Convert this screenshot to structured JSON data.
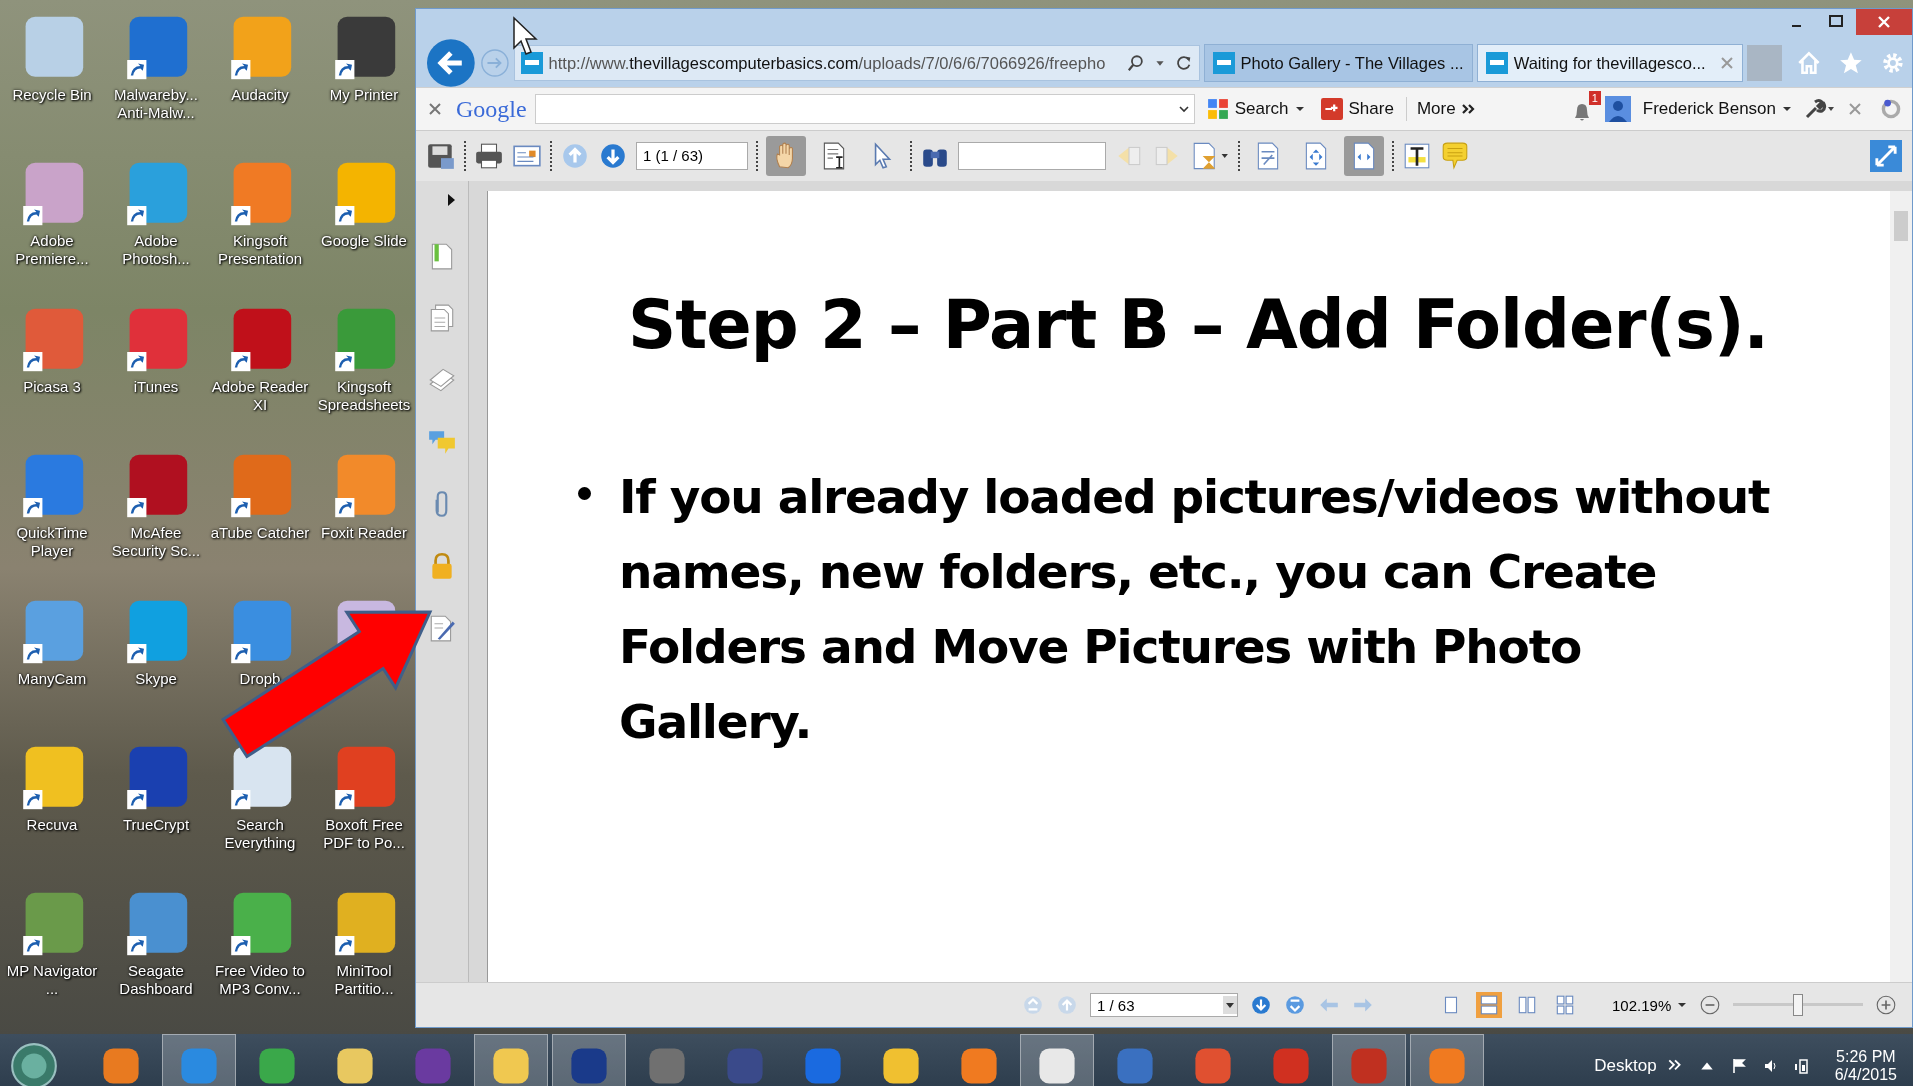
{
  "desktop_icons": [
    {
      "label": "Recycle Bin",
      "shortcut": false,
      "color": "#b8d0e6"
    },
    {
      "label": "Malwareby... Anti-Malw...",
      "shortcut": true,
      "color": "#1f6fd0"
    },
    {
      "label": "Audacity",
      "shortcut": true,
      "color": "#f2a21a"
    },
    {
      "label": "My Printer",
      "shortcut": true,
      "color": "#3a3a3a"
    },
    {
      "label": "Adobe Premiere...",
      "shortcut": true,
      "color": "#c9a3c9"
    },
    {
      "label": "Adobe Photosh...",
      "shortcut": true,
      "color": "#2aa0dc"
    },
    {
      "label": "Kingsoft Presentation",
      "shortcut": true,
      "color": "#f07a24"
    },
    {
      "label": "Google Slide",
      "shortcut": true,
      "color": "#f4b400"
    },
    {
      "label": "Picasa 3",
      "shortcut": true,
      "color": "#e05a3a"
    },
    {
      "label": "iTunes",
      "shortcut": true,
      "color": "#e0303a"
    },
    {
      "label": "Adobe Reader XI",
      "shortcut": true,
      "color": "#c0101a"
    },
    {
      "label": "Kingsoft Spreadsheets",
      "shortcut": true,
      "color": "#3a9a3a"
    },
    {
      "label": "QuickTime Player",
      "shortcut": true,
      "color": "#2a7ae0"
    },
    {
      "label": "McAfee Security Sc...",
      "shortcut": true,
      "color": "#b01020"
    },
    {
      "label": "aTube Catcher",
      "shortcut": true,
      "color": "#e06a1a"
    },
    {
      "label": "Foxit Reader",
      "shortcut": true,
      "color": "#f28a2a"
    },
    {
      "label": "ManyCam",
      "shortcut": true,
      "color": "#5aa0e0"
    },
    {
      "label": "Skype",
      "shortcut": true,
      "color": "#10a0e0"
    },
    {
      "label": "Dropb",
      "shortcut": true,
      "color": "#3a8ee0"
    },
    {
      "shortcut": false,
      "color": "#c8b8e0"
    },
    {
      "label": "Recuva",
      "shortcut": true,
      "color": "#f0c020"
    },
    {
      "label": "TrueCrypt",
      "shortcut": true,
      "color": "#1a40b0"
    },
    {
      "label": "Search Everything",
      "shortcut": true,
      "color": "#d8e4f0"
    },
    {
      "label": "Boxoft Free PDF to Po...",
      "shortcut": true,
      "color": "#e04020"
    },
    {
      "label": "MP Navigator ...",
      "shortcut": true,
      "color": "#6a9a4a"
    },
    {
      "label": "Seagate Dashboard",
      "shortcut": true,
      "color": "#4a90d0"
    },
    {
      "label": "Free Video to MP3 Conv...",
      "shortcut": true,
      "color": "#4ab04a"
    },
    {
      "label": "MiniTool Partitio...",
      "shortcut": true,
      "color": "#e0b020"
    }
  ],
  "browser": {
    "address": {
      "prefix": "http://www.",
      "host": "thevillagescomputerbasics.com",
      "path": "/uploads/7/0/6/6/7066926/freepho"
    },
    "tabs": [
      {
        "label": "Photo Gallery - The Villages ...",
        "selected": false
      },
      {
        "label": "Waiting for thevillagesco...",
        "selected": true
      }
    ],
    "google_toolbar": {
      "logo": "Google",
      "search": "Search",
      "share": "Share",
      "more": "More",
      "notifications": "1",
      "user": "Frederick Benson"
    },
    "pdf_toolbar": {
      "page_field": "1 (1 / 63)",
      "tool_modes": [
        {
          "selected": true
        },
        {
          "selected": false
        },
        {
          "selected": false
        }
      ],
      "zoom_modes": [
        {
          "selected": false
        },
        {
          "selected": false
        },
        {
          "selected": true
        }
      ]
    },
    "document": {
      "title": "Step 2 – Part B – Add Folder(s).",
      "bullets": [
        "If you already loaded pictures/videos without names, new folders, etc., you can Create Folders and Move Pictures with Photo Gallery."
      ]
    },
    "status_bar": {
      "page_field": "1 / 63",
      "view_modes": [
        {
          "selected": false
        },
        {
          "selected": true
        },
        {
          "selected": false
        },
        {
          "selected": false
        }
      ],
      "zoom": "102.19%",
      "zoom_slider": {
        "level": 0.5
      }
    }
  },
  "taskbar": {
    "apps": [
      {
        "color": "#e87a20",
        "running": false
      },
      {
        "color": "#2a8ae0",
        "running": true
      },
      {
        "color": "#3aa84a",
        "running": false
      },
      {
        "color": "#e8c860",
        "running": false
      },
      {
        "color": "#6a3aa0",
        "running": false
      },
      {
        "color": "#f0c850",
        "running": true
      },
      {
        "color": "#1a3a8a",
        "running": true
      },
      {
        "color": "#707070",
        "running": false
      },
      {
        "color": "#3a4a8a",
        "running": false
      },
      {
        "color": "#1a6ae0",
        "running": false
      },
      {
        "color": "#f0c030",
        "running": false
      },
      {
        "color": "#f07a20",
        "running": false
      },
      {
        "color": "#e8e8e8",
        "running": true
      },
      {
        "color": "#3a70c0",
        "running": false
      },
      {
        "color": "#e05030",
        "running": false
      },
      {
        "color": "#d03020",
        "running": false
      },
      {
        "color": "#c03020",
        "running": true
      },
      {
        "color": "#f07a20",
        "running": true
      }
    ],
    "desktop_label": "Desktop",
    "time": "5:26 PM",
    "date": "6/4/2015"
  }
}
